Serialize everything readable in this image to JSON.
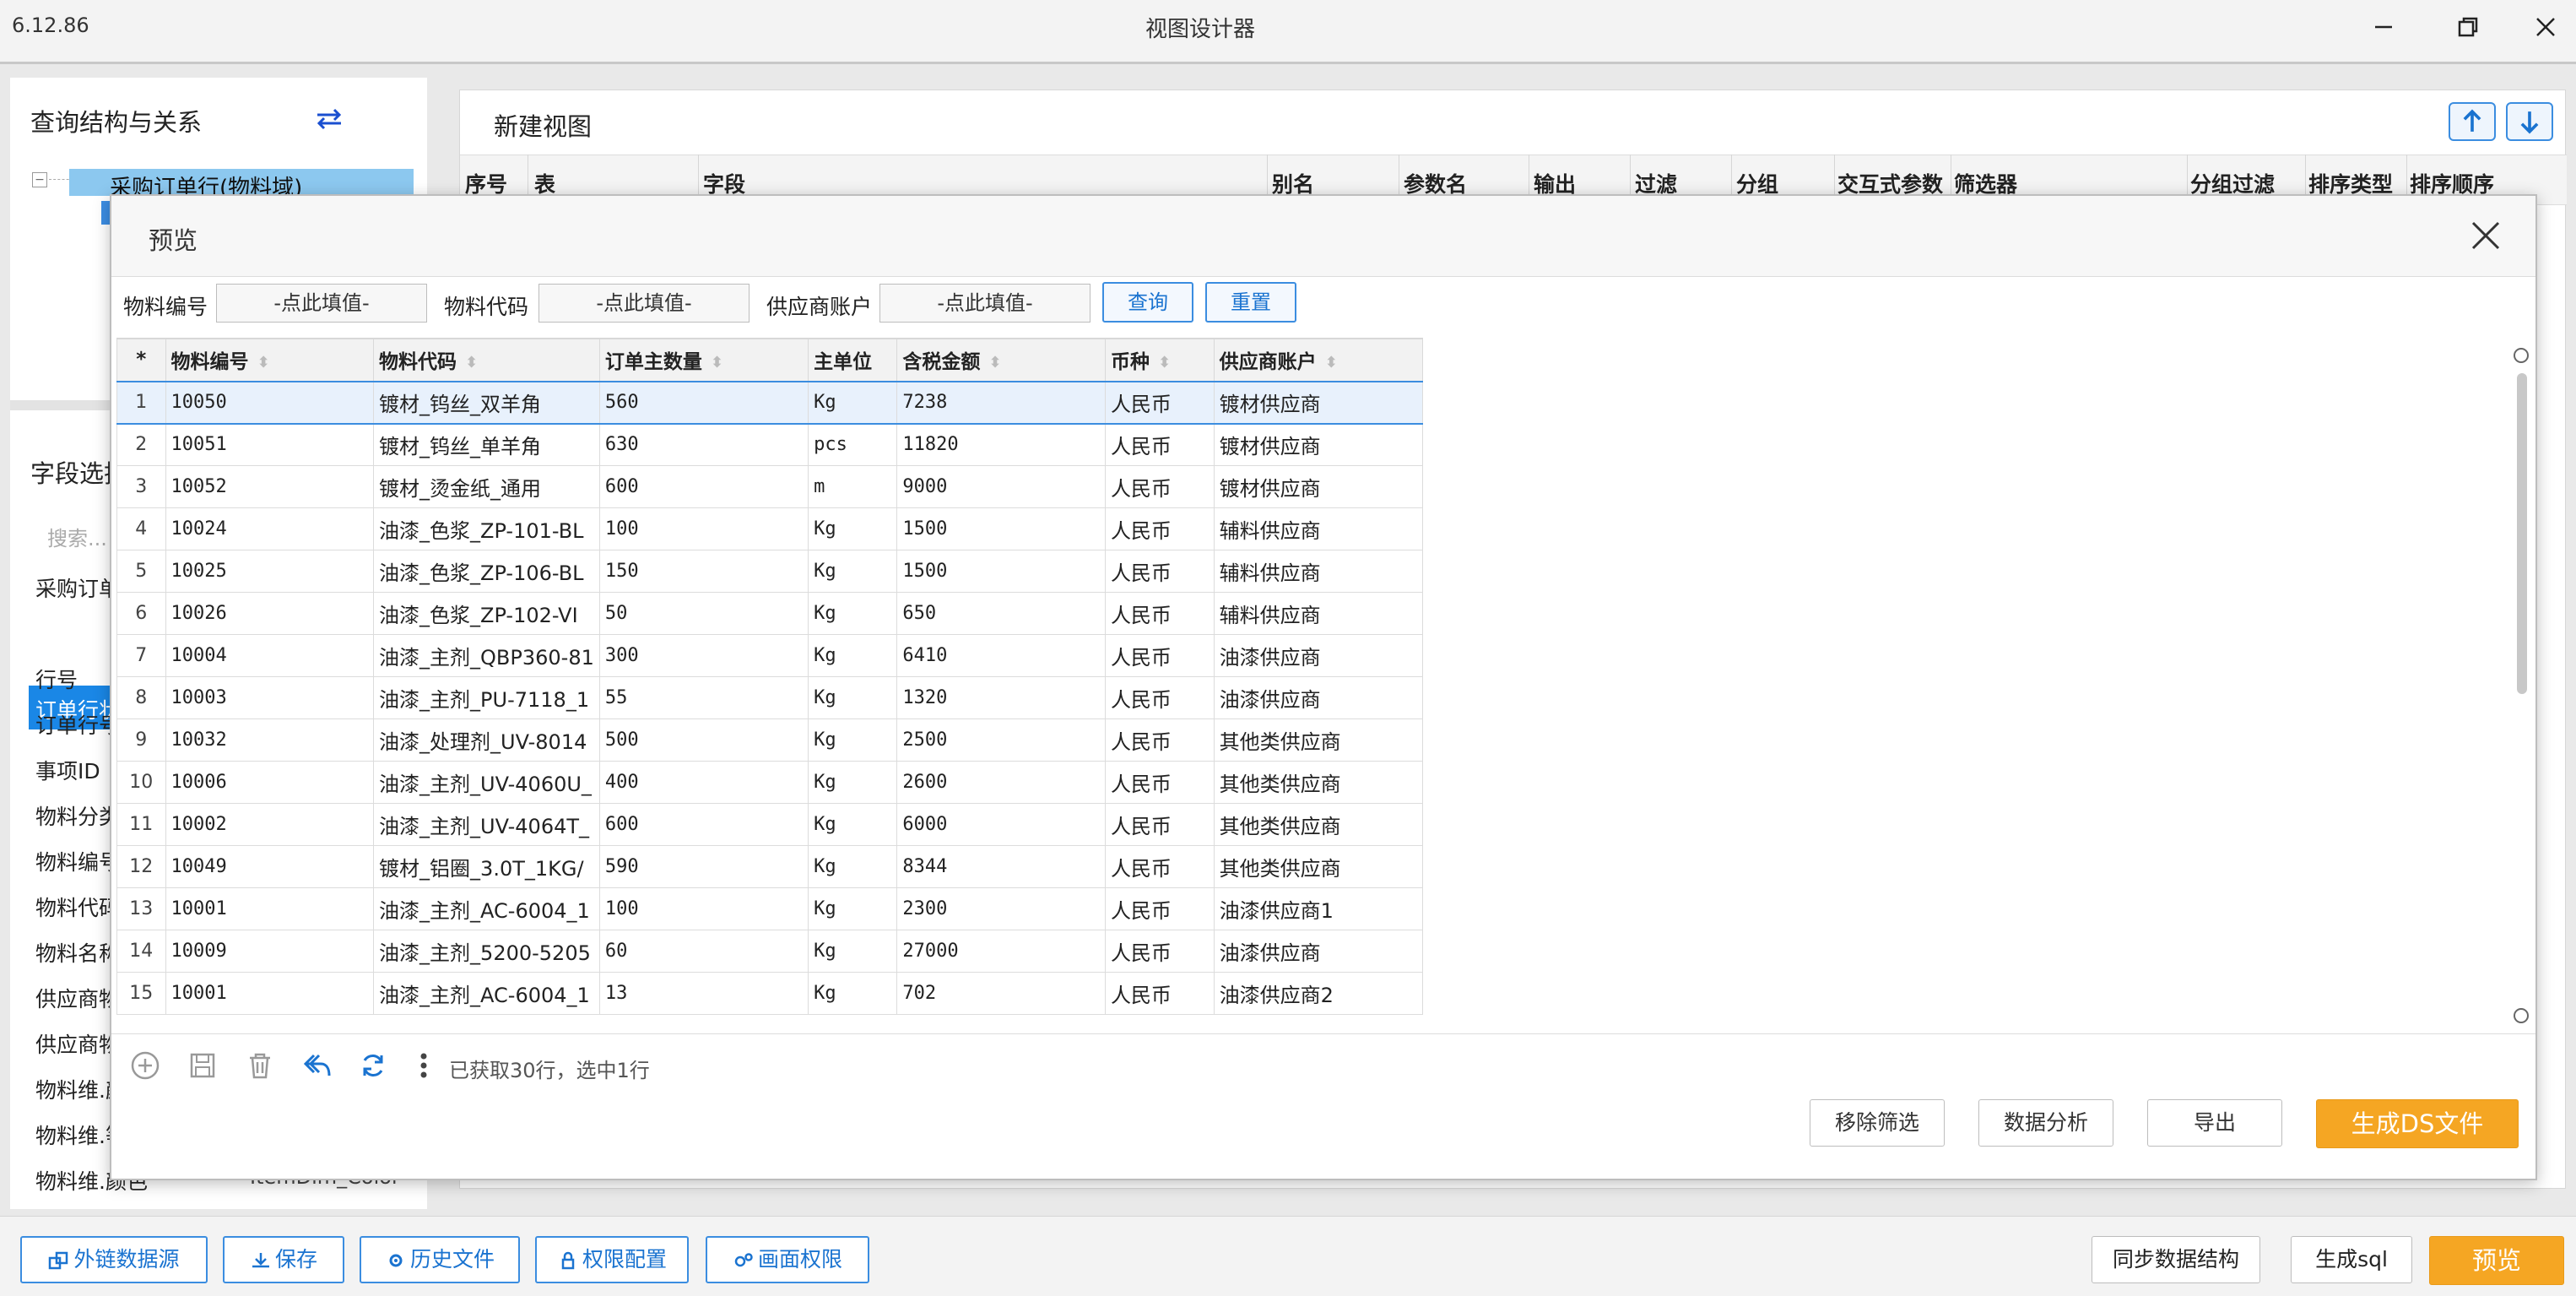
{
  "window": {
    "version": "6.12.86",
    "title": "视图设计器"
  },
  "left_panel": {
    "section_title": "查询结构与关系",
    "tree_root": "采购订单行(物料域)",
    "field_select_title": "字段选择",
    "search_placeholder": "搜索...",
    "items": [
      "采购订单",
      "订单行状",
      "行号",
      "订单行号",
      "事项ID",
      "物料分类",
      "物料编号",
      "物料代码",
      "物料名称",
      "供应商物",
      "供应商物",
      "物料维.颜",
      "物料维.等",
      "物料维.颜色"
    ],
    "last_item_right": "ItemDim_Color"
  },
  "design": {
    "view_title": "新建视图",
    "columns": [
      "序号",
      "表",
      "字段",
      "别名",
      "参数名",
      "输出",
      "过滤",
      "分组",
      "交互式参数",
      "筛选器",
      "分组过滤",
      "排序类型",
      "排序顺序"
    ]
  },
  "modal": {
    "title": "预览",
    "filters": [
      {
        "label": "物料编号",
        "placeholder": "-点此填值-"
      },
      {
        "label": "物料代码",
        "placeholder": "-点此填值-"
      },
      {
        "label": "供应商账户",
        "placeholder": "-点此填值-"
      }
    ],
    "query_button": "查询",
    "reset_button": "重置",
    "table": {
      "star": "*",
      "headers": [
        "物料编号",
        "物料代码",
        "订单主数量",
        "主单位",
        "含税金额",
        "币种",
        "供应商账户"
      ],
      "rows": [
        [
          "1",
          "10050",
          "镀材_钨丝_双羊角",
          "560",
          "Kg",
          "7238",
          "人民币",
          "镀材供应商"
        ],
        [
          "2",
          "10051",
          "镀材_钨丝_单羊角",
          "630",
          "pcs",
          "11820",
          "人民币",
          "镀材供应商"
        ],
        [
          "3",
          "10052",
          "镀材_烫金纸_通用",
          "600",
          "m",
          "9000",
          "人民币",
          "镀材供应商"
        ],
        [
          "4",
          "10024",
          "油漆_色浆_ZP-101-BL",
          "100",
          "Kg",
          "1500",
          "人民币",
          "辅料供应商"
        ],
        [
          "5",
          "10025",
          "油漆_色浆_ZP-106-BL",
          "150",
          "Kg",
          "1500",
          "人民币",
          "辅料供应商"
        ],
        [
          "6",
          "10026",
          "油漆_色浆_ZP-102-VI",
          "50",
          "Kg",
          "650",
          "人民币",
          "辅料供应商"
        ],
        [
          "7",
          "10004",
          "油漆_主剂_QBP360-81",
          "300",
          "Kg",
          "6410",
          "人民币",
          "油漆供应商"
        ],
        [
          "8",
          "10003",
          "油漆_主剂_PU-7118_1",
          "55",
          "Kg",
          "1320",
          "人民币",
          "油漆供应商"
        ],
        [
          "9",
          "10032",
          "油漆_处理剂_UV-8014",
          "500",
          "Kg",
          "2500",
          "人民币",
          "其他类供应商"
        ],
        [
          "10",
          "10006",
          "油漆_主剂_UV-4060U_",
          "400",
          "Kg",
          "2600",
          "人民币",
          "其他类供应商"
        ],
        [
          "11",
          "10002",
          "油漆_主剂_UV-4064T_",
          "600",
          "Kg",
          "6000",
          "人民币",
          "其他类供应商"
        ],
        [
          "12",
          "10049",
          "镀材_铝圈_3.0T_1KG/",
          "590",
          "Kg",
          "8344",
          "人民币",
          "其他类供应商"
        ],
        [
          "13",
          "10001",
          "油漆_主剂_AC-6004_1",
          "100",
          "Kg",
          "2300",
          "人民币",
          "油漆供应商1"
        ],
        [
          "14",
          "10009",
          "油漆_主剂_5200-5205",
          "60",
          "Kg",
          "27000",
          "人民币",
          "油漆供应商"
        ],
        [
          "15",
          "10001",
          "油漆_主剂_AC-6004_1",
          "13",
          "Kg",
          "702",
          "人民币",
          "油漆供应商2"
        ]
      ]
    },
    "status_text": "已获取30行，选中1行",
    "buttons": {
      "remove_filter": "移除筛选",
      "data_analysis": "数据分析",
      "export": "导出",
      "generate_ds": "生成DS文件"
    }
  },
  "bottom_bar": {
    "external_source": "外链数据源",
    "save": "保存",
    "history": "历史文件",
    "permission": "权限配置",
    "screen_permission": "画面权限",
    "sync_structure": "同步数据结构",
    "generate_sql": "生成sql",
    "preview": "预览"
  },
  "colors": {
    "accent_blue": "#3b8de0",
    "primary_orange": "#f5a623",
    "selection_blue": "#1a87e6"
  }
}
